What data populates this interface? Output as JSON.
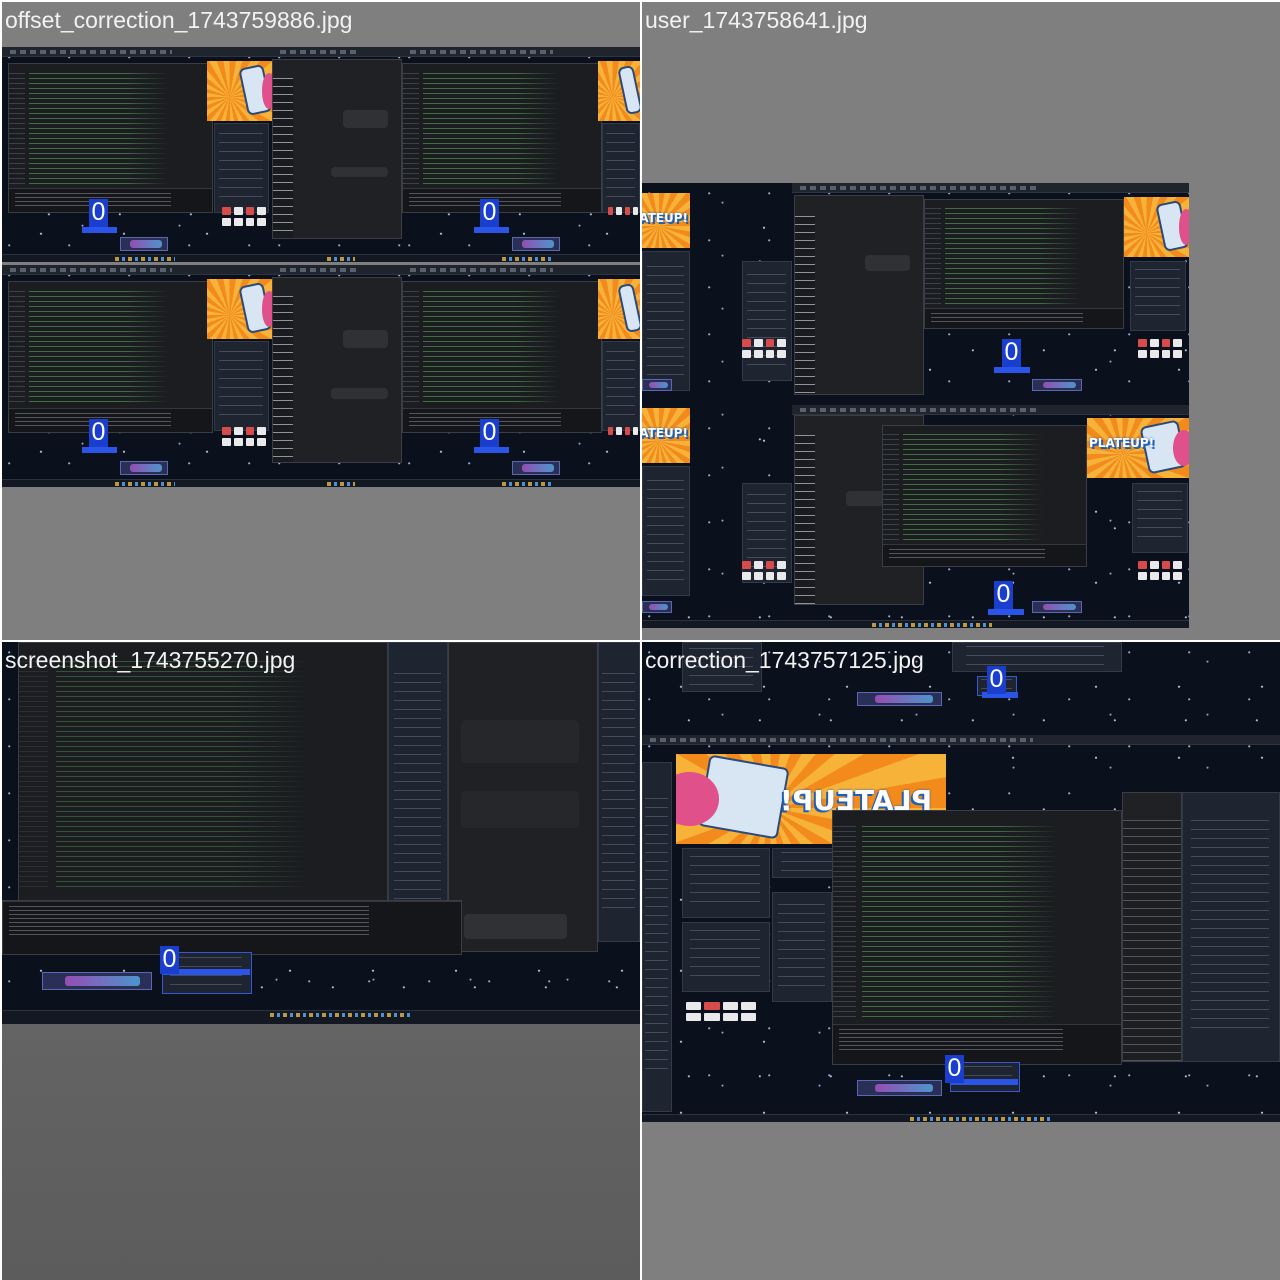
{
  "tiles": [
    {
      "filename": "offset_correction_1743759886.jpg",
      "badges": [
        "0",
        "0",
        "0",
        "0"
      ]
    },
    {
      "filename": "user_1743758641.jpg",
      "badges": [
        "0",
        "0"
      ]
    },
    {
      "filename": "screenshot_1743755270.jpg",
      "badges": [
        "0"
      ]
    },
    {
      "filename": "correction_1743757125.jpg",
      "badges": [
        "0",
        "0"
      ]
    }
  ],
  "game_logo_text": "PLATEUP!",
  "colors": {
    "tile_background": "#7f7f7f",
    "badge": "#1a3fcf",
    "desktop": "#0b111c",
    "banner_orange": "#f28a1c"
  }
}
